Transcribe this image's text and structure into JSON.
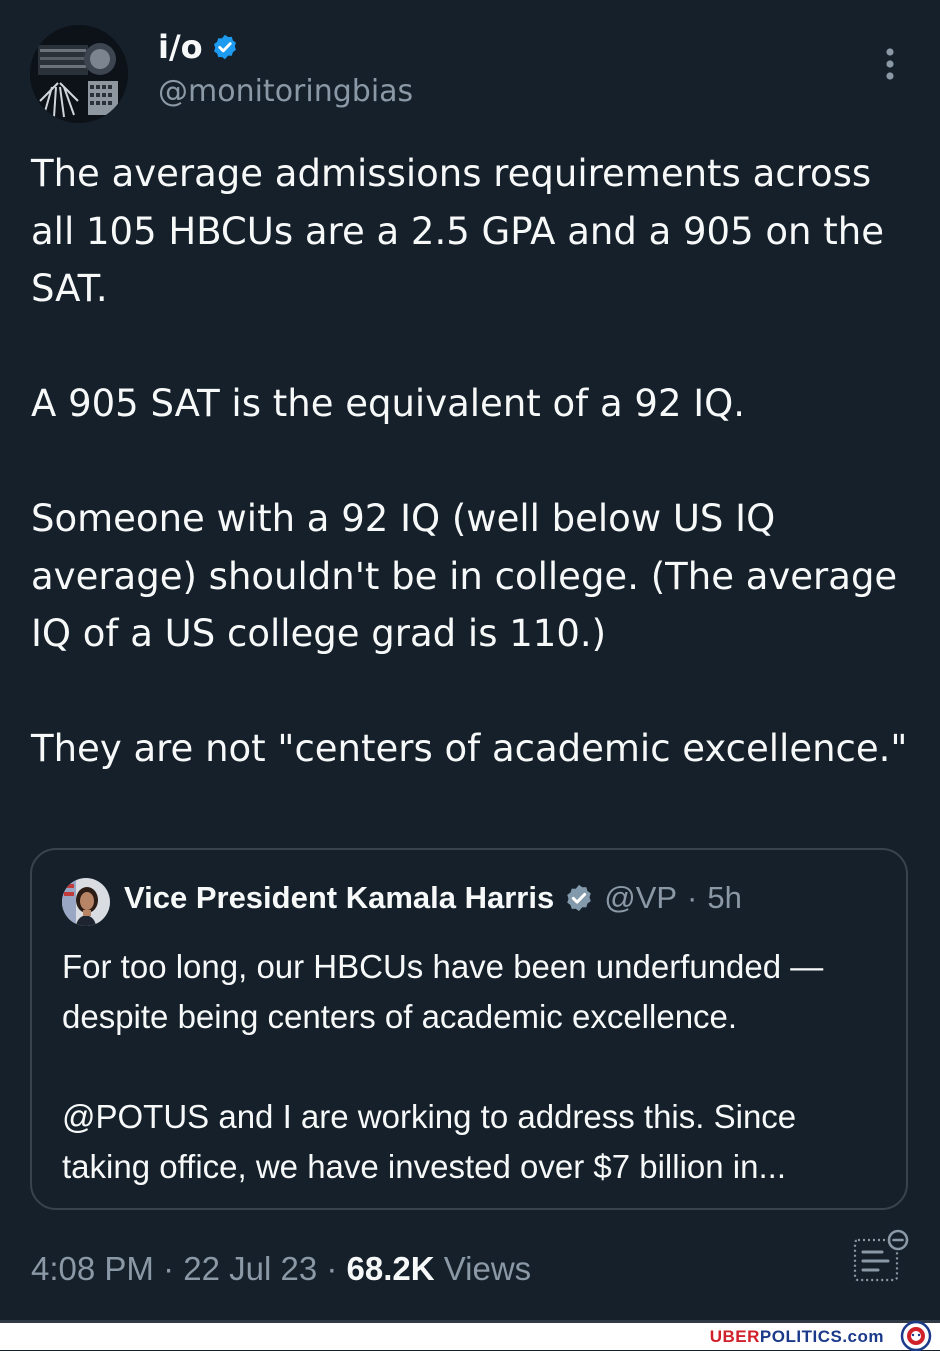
{
  "tweet": {
    "author": {
      "display_name": "i/o",
      "handle": "@monitoringbias",
      "verified": true
    },
    "paragraphs": [
      "The average admissions requirements across all 105 HBCUs are a 2.5 GPA and a 905 on the SAT.",
      "A 905 SAT is the equivalent of a 92 IQ.",
      "Someone with a 92 IQ (well below US IQ average) shouldn't be in college. (The average IQ of a US college grad is 110.)",
      "They are not \"centers of academic excellence.\""
    ],
    "quoted": {
      "display_name": "Vice President Kamala Harris",
      "handle": "@VP",
      "separator": "·",
      "age": "5h",
      "paragraphs": [
        "For too long, our HBCUs have been underfunded — despite being centers of academic excellence.",
        "@POTUS and I are working to address this. Since taking office, we have invested over $7 billion in..."
      ]
    },
    "footer": {
      "time": "4:08 PM",
      "sep1": " · ",
      "date": "22 Jul 23",
      "sep2": " · ",
      "views_count": "68.2K",
      "views_label": " Views"
    }
  },
  "watermark": {
    "part1": "UBER",
    "part2": "POLITICS.com"
  },
  "colors": {
    "background": "#15202b",
    "text": "#f7f9f9",
    "muted": "#8b98a5",
    "verified_blue": "#1d9bf0",
    "gov_gray": "#829aab",
    "border": "#38444d"
  },
  "icons": {
    "verified": "verified-badge-icon",
    "gov_verified": "gray-verified-badge-icon",
    "more": "more-vertical-icon",
    "analytics": "post-analytics-icon"
  }
}
